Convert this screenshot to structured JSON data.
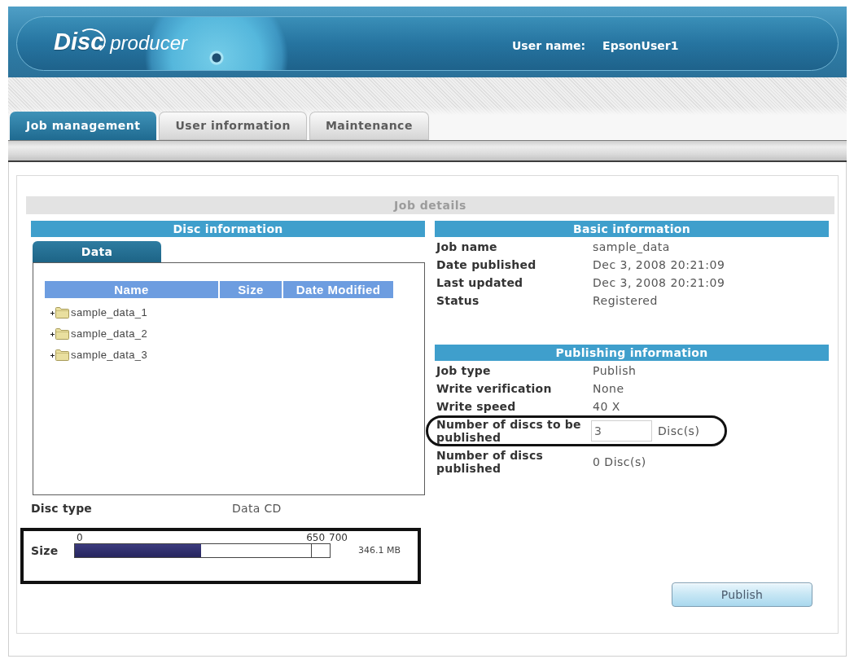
{
  "header": {
    "logo": {
      "bold": "Disc",
      "rest": "producer"
    },
    "user_label": "User name:",
    "user_name": "EpsonUser1"
  },
  "tabs": [
    {
      "label": "Job management",
      "selected": true
    },
    {
      "label": "User information",
      "selected": false
    },
    {
      "label": "Maintenance",
      "selected": false
    }
  ],
  "job_details": {
    "title": "Job details",
    "disc_information": {
      "title": "Disc information",
      "tabs": [
        {
          "label": "Data",
          "selected": true
        }
      ],
      "file_table": {
        "columns": [
          "Name",
          "Size",
          "Date Modified"
        ],
        "rows": [
          {
            "name": "sample_data_1",
            "kind": "folder",
            "expanded": false
          },
          {
            "name": "sample_data_2",
            "kind": "folder",
            "expanded": false
          },
          {
            "name": "sample_data_3",
            "kind": "folder",
            "expanded": false
          }
        ]
      },
      "disc_type": {
        "label": "Disc type",
        "value": "Data CD"
      },
      "size": {
        "label": "Size",
        "scale": [
          "0",
          "650",
          "700"
        ],
        "level": 0.494,
        "reading": "346.1 MB",
        "highlighted": true
      }
    },
    "basic_information": {
      "title": "Basic information",
      "rows": [
        {
          "label": "Job name",
          "value": "sample_data"
        },
        {
          "label": "Date published",
          "value": "Dec 3, 2008 20:21:09"
        },
        {
          "label": "Last updated",
          "value": "Dec 3, 2008 20:21:09"
        },
        {
          "label": "Status",
          "value": "Registered"
        }
      ]
    },
    "publishing_information": {
      "title": "Publishing information",
      "rows": [
        {
          "kind": "text",
          "label": "Job type",
          "value": "Publish",
          "highlighted": false
        },
        {
          "kind": "text",
          "label": "Write verification",
          "value": "None",
          "highlighted": false
        },
        {
          "kind": "text",
          "label": "Write speed",
          "value": "40 X",
          "highlighted": false
        },
        {
          "kind": "input",
          "label": "Number of discs to be published",
          "value": "3",
          "unit": "Disc(s)",
          "highlighted": true
        },
        {
          "kind": "text",
          "label": "Number of discs published",
          "value": "0 Disc(s)",
          "highlighted": false
        }
      ]
    },
    "buttons": [
      {
        "label": "Publish"
      }
    ]
  }
}
